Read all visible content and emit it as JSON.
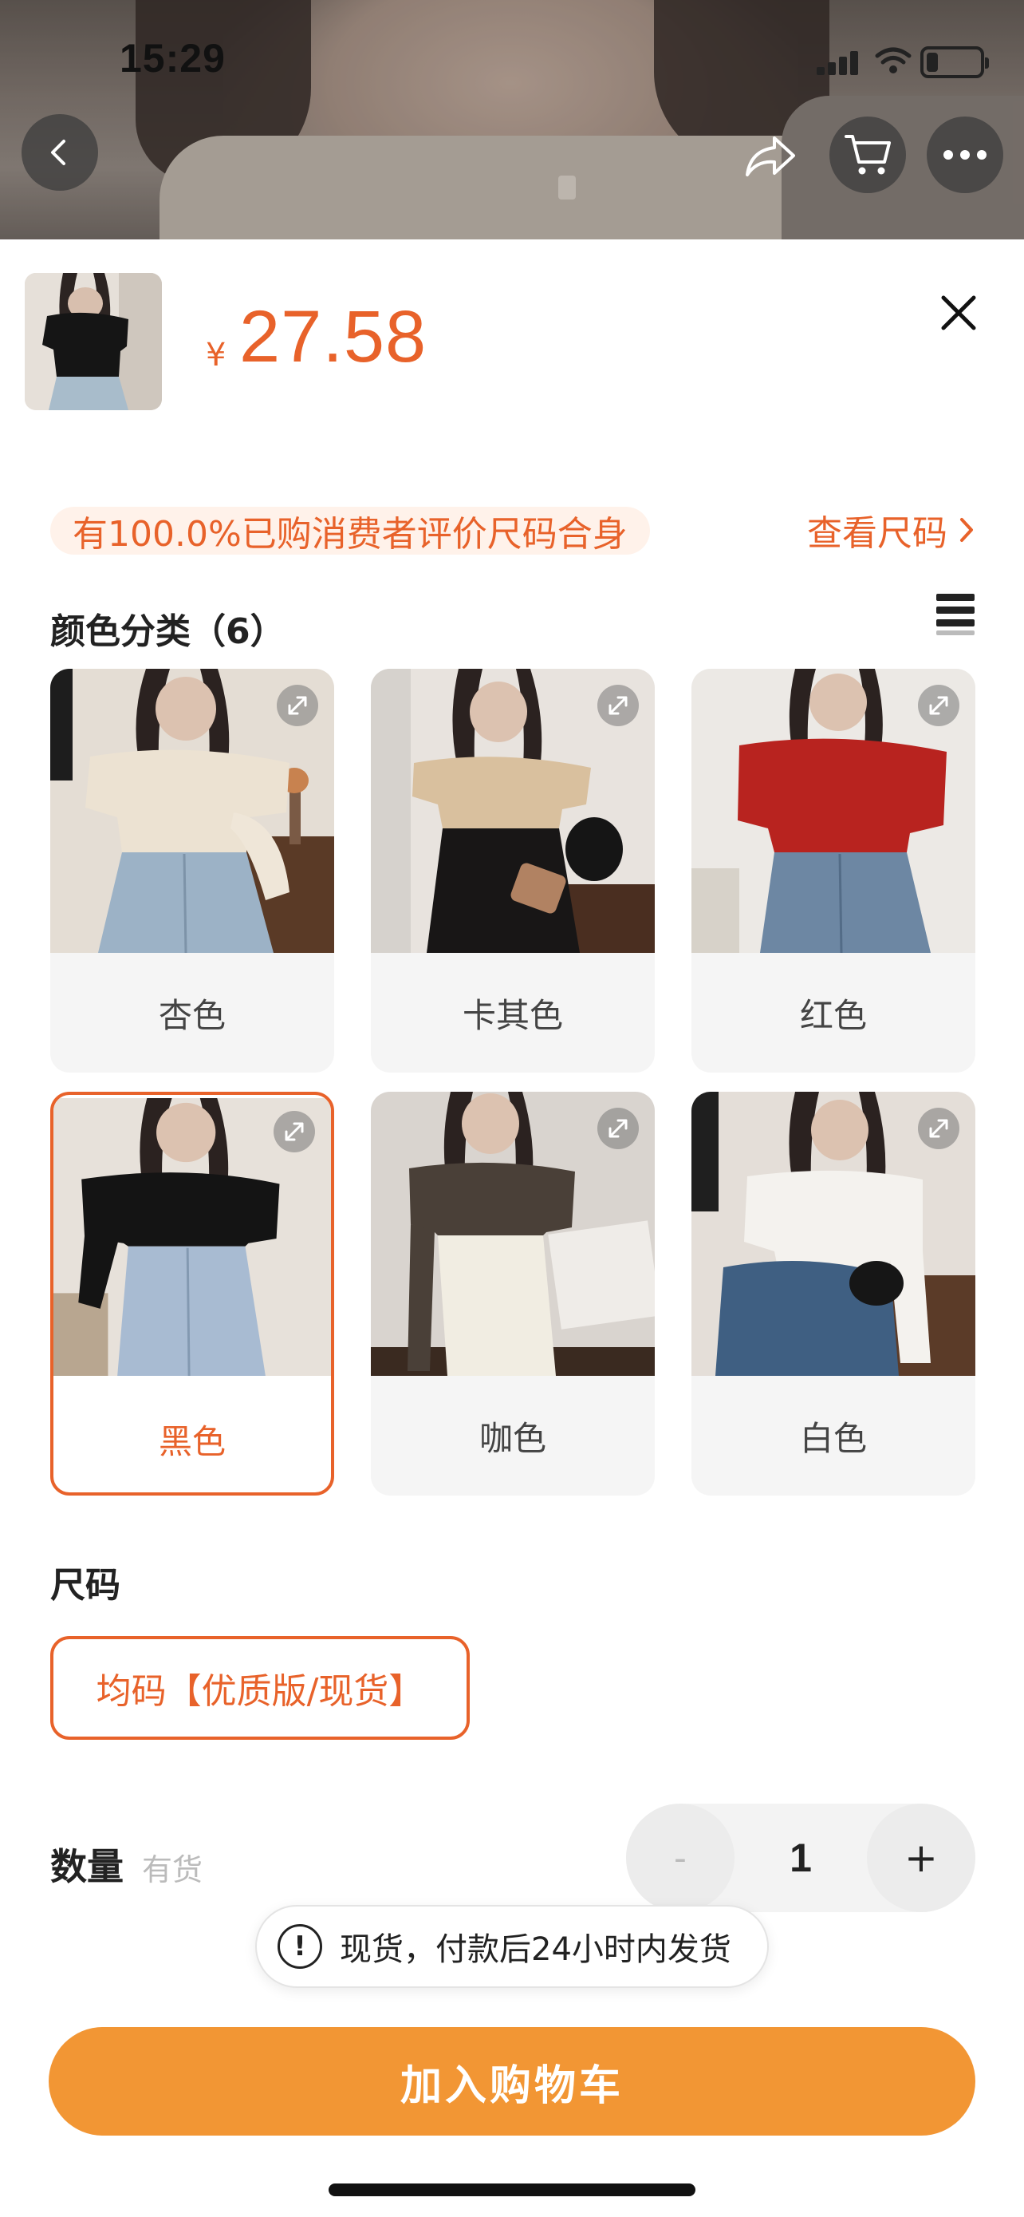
{
  "status_bar": {
    "time": "15:29"
  },
  "product": {
    "currency_symbol": "¥",
    "price": "27.58"
  },
  "fit_notice": {
    "text": "有100.0%已购消费者评价尺码合身",
    "size_link_label": "查看尺码"
  },
  "color_section": {
    "title": "颜色分类（6）",
    "options": [
      {
        "label": "杏色",
        "selected": false
      },
      {
        "label": "卡其色",
        "selected": false
      },
      {
        "label": "红色",
        "selected": false
      },
      {
        "label": "黑色",
        "selected": true
      },
      {
        "label": "咖色",
        "selected": false
      },
      {
        "label": "白色",
        "selected": false
      }
    ]
  },
  "size_section": {
    "title": "尺码",
    "option": "均码【优质版/现货】"
  },
  "quantity": {
    "label": "数量",
    "stock_status": "有货",
    "value": "1",
    "minus_label": "-",
    "plus_label": "+"
  },
  "toast": {
    "text": "现货，付款后24小时内发货"
  },
  "add_to_cart": {
    "label": "加入购物车"
  },
  "colors": {
    "accent": "#e8622a",
    "cart_button": "#f29634"
  }
}
